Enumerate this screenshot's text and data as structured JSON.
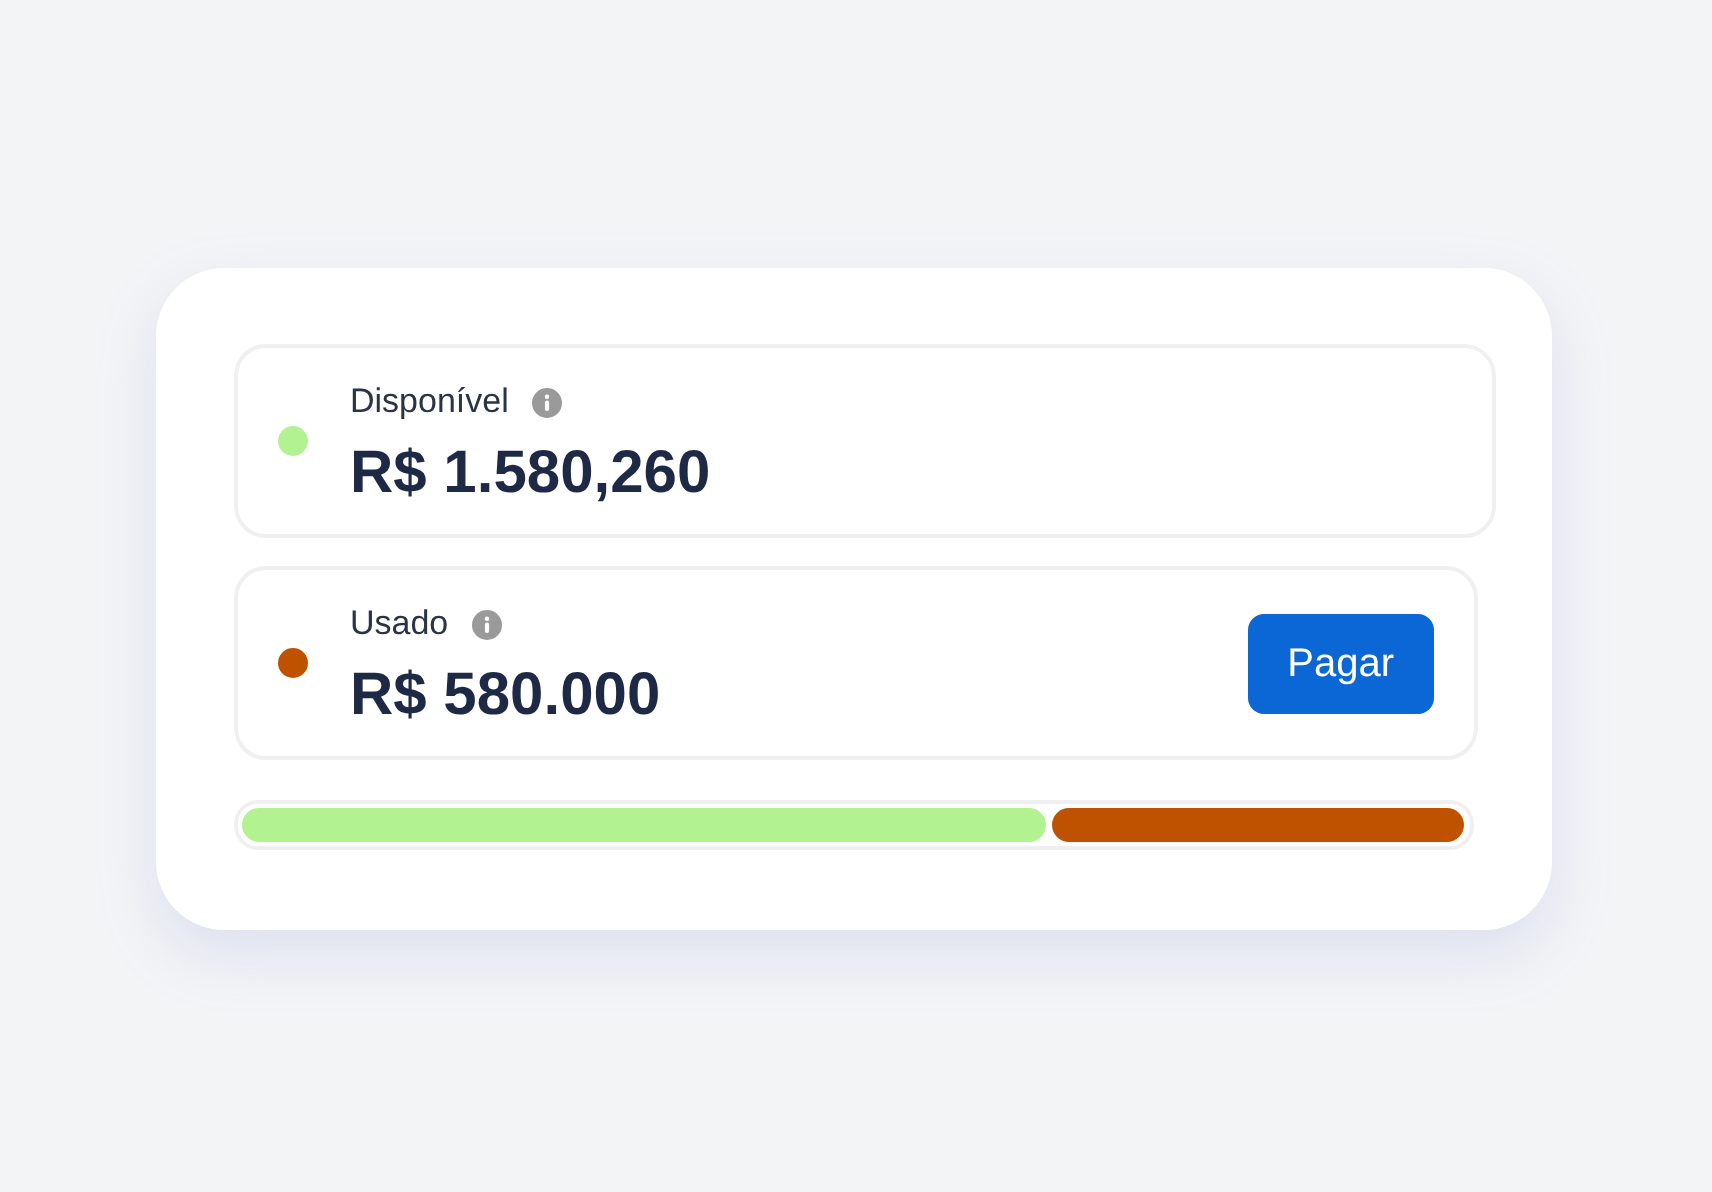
{
  "balances": [
    {
      "label": "Disponível",
      "amount": "R$ 1.580,260",
      "color": "#b3f291"
    },
    {
      "label": "Usado",
      "amount": "R$ 580.000",
      "color": "#bf5200",
      "button": "Pagar"
    }
  ],
  "usage_bar": {
    "segments": [
      {
        "level": 0.66,
        "color": "#b3f291"
      },
      {
        "level": 0.34,
        "color": "#bf5200"
      }
    ]
  }
}
